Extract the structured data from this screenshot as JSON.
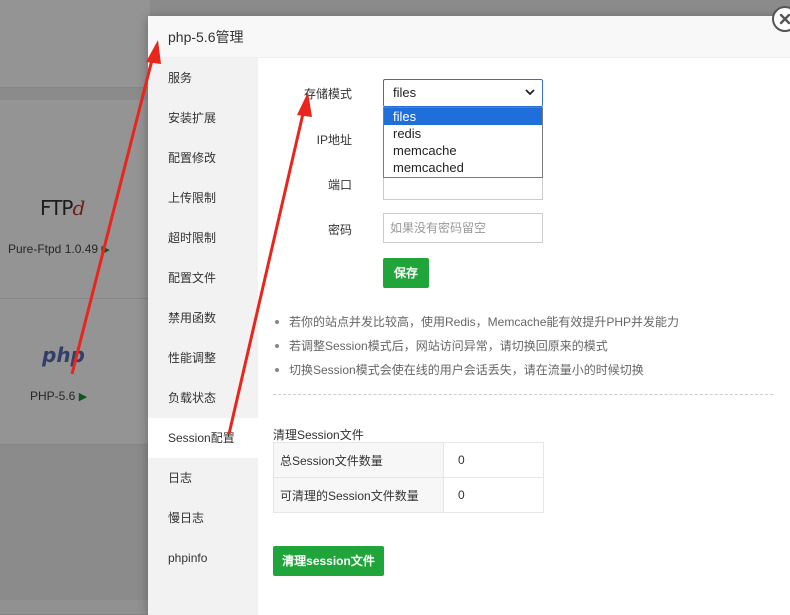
{
  "background": {
    "ftp_logo": "FTP",
    "ftp_logo_d": "d",
    "ftp_label": "Pure-Ftpd 1.0.49",
    "php_logo": "php",
    "php_label": "PHP-5.6",
    "play_icon": "▶"
  },
  "dialog": {
    "title": "php-5.6管理",
    "sidebar": [
      {
        "label": "服务"
      },
      {
        "label": "安装扩展"
      },
      {
        "label": "配置修改"
      },
      {
        "label": "上传限制"
      },
      {
        "label": "超时限制"
      },
      {
        "label": "配置文件"
      },
      {
        "label": "禁用函数"
      },
      {
        "label": "性能调整"
      },
      {
        "label": "负载状态"
      },
      {
        "label": "Session配置",
        "active": true
      },
      {
        "label": "日志"
      },
      {
        "label": "慢日志"
      },
      {
        "label": "phpinfo"
      }
    ],
    "form": {
      "storage_label": "存储模式",
      "storage_value": "files",
      "storage_options": [
        "files",
        "redis",
        "memcache",
        "memcached"
      ],
      "ip_label": "IP地址",
      "port_label": "端口",
      "password_label": "密码",
      "password_placeholder": "如果没有密码留空",
      "save_label": "保存"
    },
    "tips": [
      "若你的站点并发比较高，使用Redis，Memcache能有效提升PHP并发能力",
      "若调整Session模式后，网站访问异常，请切换回原来的模式",
      "切换Session模式会使在线的用户会话丢失，请在流量小的时候切换"
    ],
    "session_section": {
      "title": "清理Session文件",
      "rows": [
        {
          "key": "总Session文件数量",
          "value": "0"
        },
        {
          "key": "可清理的Session文件数量",
          "value": "0"
        }
      ],
      "clean_label": "清理session文件"
    }
  },
  "colors": {
    "accent_green": "#20a53a",
    "select_blue": "#1e6fd9",
    "arrow_red": "#e8261c"
  }
}
